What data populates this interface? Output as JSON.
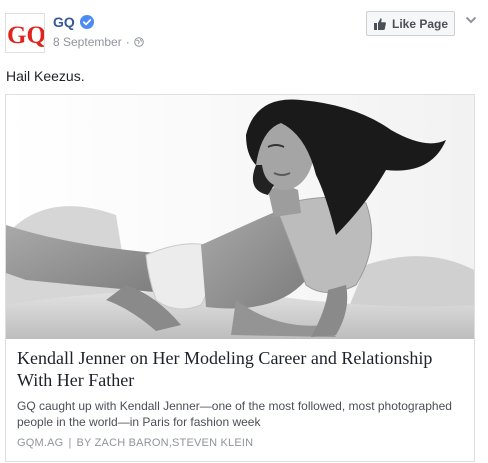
{
  "page": {
    "name": "GQ",
    "logo_text": "GQ",
    "date": "8 September",
    "dot": "·",
    "like_button": "Like Page"
  },
  "post": {
    "text": "Hail Keezus."
  },
  "attachment": {
    "headline": "Kendall Jenner on Her Modeling Career and Relationship With Her Father",
    "description": "GQ caught up with Kendall Jenner—one of the most followed, most photographed people in the world—in Paris for fashion week",
    "domain": "GQM.AG",
    "separator": "|",
    "byline": "BY ZACH BARON,STEVEN KLEIN"
  },
  "colors": {
    "brand_red": "#e0241b",
    "link_blue": "#365899",
    "verified_blue": "#4c8bf5"
  },
  "icons": [
    "gq-logo",
    "verified-badge-icon",
    "globe-icon",
    "thumbs-up-icon",
    "chevron-down-icon"
  ]
}
